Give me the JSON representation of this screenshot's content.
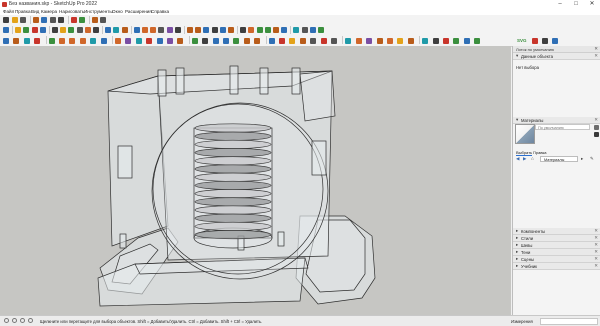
{
  "window": {
    "title": "Без названия.skp - SketchUp Pro 2022",
    "minimize": "–",
    "maximize": "□",
    "close": "✕"
  },
  "menu": [
    "Файл",
    "Правка",
    "Вид",
    "Камера",
    "Нарисовать",
    "Инструменты",
    "Окно",
    "Расширения",
    "Справка"
  ],
  "toolbar_icons": {
    "row1": [
      "new-icon",
      "open-icon",
      "save-icon",
      "cut-icon",
      "copy-icon",
      "paste-icon",
      "erase-icon",
      "undo-icon",
      "redo-icon",
      "print-icon",
      "model-info-icon"
    ],
    "row2": [
      "select-icon",
      "make-component-icon",
      "paint-bucket-icon",
      "eraser-icon",
      "line-icon",
      "freehand-icon",
      "rectangle-icon",
      "rotated-rectangle-icon",
      "circle-icon",
      "polygon-icon",
      "arc-icon",
      "two-point-arc-icon",
      "three-point-arc-icon",
      "pie-icon",
      "move-icon",
      "push-pull-icon",
      "rotate-icon",
      "follow-me-icon",
      "scale-icon",
      "offset-icon",
      "tape-measure-icon",
      "dimension-icon",
      "protractor-icon",
      "text-icon",
      "axes-icon",
      "3d-text-icon",
      "orbit-icon",
      "pan-icon",
      "zoom-icon",
      "zoom-window-icon",
      "zoom-extents-icon",
      "previous-view-icon",
      "position-camera-icon",
      "look-around-icon",
      "walk-icon",
      "section-plane-icon"
    ],
    "row3": [
      "cursor-icon",
      "component-icon",
      "paint-icon",
      "eraser-icon",
      "pencil-icon",
      "rectangle-icon",
      "circle-icon",
      "arc-icon",
      "polygon-icon",
      "push-pull-icon",
      "move-icon",
      "rotate-icon",
      "scale-icon",
      "offset-icon",
      "tape-icon",
      "text-icon",
      "axes-icon",
      "section-icon",
      "warehouse-icon",
      "extension-warehouse-icon",
      "layout-icon",
      "style-icon",
      "shadow-icon",
      "fog-icon",
      "xray-icon",
      "back-edges-icon",
      "wireframe-icon",
      "hidden-line-icon",
      "shaded-icon",
      "textured-icon",
      "monochrome-icon",
      "iso-view-icon",
      "top-view-icon",
      "front-view-icon",
      "right-view-icon",
      "back-view-icon",
      "left-view-icon",
      "bottom-view-icon",
      "sandbox-icon",
      "smoove-icon",
      "stamp-icon",
      "drape-icon",
      "add-detail-icon",
      "flip-edge-icon",
      "svg-icon",
      "export-icon",
      "tray-icon"
    ],
    "svg_label": "SVG"
  },
  "tray": {
    "title": "Лоток по умолчанию",
    "entity_panel": {
      "title": "Данные объекта",
      "empty_text": "Нет выбора"
    },
    "materials_panel": {
      "title": "Материалы",
      "input_placeholder": "По умолчанию",
      "tabs": [
        "Выбрать",
        "Правка"
      ],
      "select_value": "Материалы"
    },
    "collapsed_panels": [
      "Компоненты",
      "Стили",
      "Шевы",
      "Тени",
      "Сцены",
      "Учебник"
    ]
  },
  "status": {
    "text": "Щелкните или перетащите для выбора объектов. Shift = Добавить/Удалить. Ctrl = Добавить. Shift + Ctrl = Удалить.",
    "measurements_label": "Измерения",
    "measurements_value": ""
  },
  "colors": {
    "viewport_bg": "#c6c6c3",
    "model_fill": "#e8ecee",
    "model_edge": "#2e2e2e",
    "spring_dark": "#3a3a3a",
    "brand_red": "#c8352b"
  }
}
